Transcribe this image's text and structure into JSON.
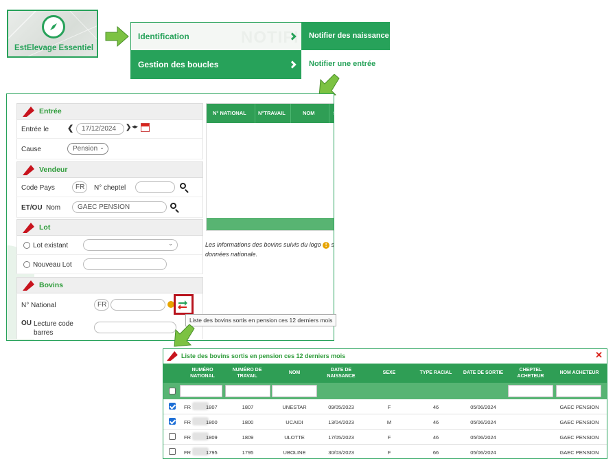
{
  "logo": {
    "text": "EstElevage Essentiel",
    "icon": "compass-icon"
  },
  "menu": {
    "watermark": "NOTIFI",
    "items": [
      {
        "label": "Identification",
        "sub": "Notifier des naissance"
      },
      {
        "label": "Gestion des boucles",
        "sub": "Notifier une entrée"
      }
    ]
  },
  "form": {
    "entree": {
      "title": "Entrée",
      "date_label": "Entrée le",
      "date_value": "17/12/2024",
      "cause_label": "Cause",
      "cause_value": "Pension"
    },
    "vendeur": {
      "title": "Vendeur",
      "pays_label": "Code Pays",
      "pays_value": "FR",
      "cheptel_label": "N° cheptel",
      "etou": "ET/OU",
      "nom_label": "Nom",
      "nom_value": "GAEC PENSION"
    },
    "lot": {
      "title": "Lot",
      "existant_label": "Lot existant",
      "nouveau_label": "Nouveau Lot"
    },
    "bovins": {
      "title": "Bovins",
      "national_label": "N° National",
      "national_prefix": "FR",
      "ou": "OU",
      "lecture_label": "Lecture code barres"
    }
  },
  "right_table": {
    "headers": [
      "N° NATIONAL",
      "N°TRAVAIL",
      "NOM",
      "S"
    ],
    "info_text_1": "Les informations des bovins suivis du logo",
    "info_text_2": "s",
    "info_text_3": "données nationale."
  },
  "tooltip": "Liste des bovins sortis en pension ces 12 derniers mois",
  "list": {
    "title": "Liste des bovins sortis en pension ces 12 derniers mois",
    "close": "✕",
    "headers": [
      "NUMÉRO NATIONAL",
      "NUMÉRO DE TRAVAIL",
      "NOM",
      "DATE DE NAISSANCE",
      "SEXE",
      "TYPE RACIAL",
      "DATE DE SORTIE",
      "CHEPTEL ACHETEUR",
      "NOM ACHETEUR"
    ],
    "rows": [
      {
        "checked": true,
        "pays": "FR",
        "num": "1807",
        "travail": "1807",
        "nom": "UNESTAR",
        "naissance": "09/05/2023",
        "sexe": "F",
        "race": "46",
        "sortie": "05/06/2024",
        "cheptel": "",
        "acheteur": "GAEC PENSION"
      },
      {
        "checked": true,
        "pays": "FR",
        "num": "1800",
        "travail": "1800",
        "nom": "UCAIDI",
        "naissance": "13/04/2023",
        "sexe": "M",
        "race": "46",
        "sortie": "05/06/2024",
        "cheptel": "",
        "acheteur": "GAEC PENSION"
      },
      {
        "checked": false,
        "pays": "FR",
        "num": "1809",
        "travail": "1809",
        "nom": "ULOTTE",
        "naissance": "17/05/2023",
        "sexe": "F",
        "race": "46",
        "sortie": "05/06/2024",
        "cheptel": "",
        "acheteur": "GAEC PENSION"
      },
      {
        "checked": false,
        "pays": "FR",
        "num": "1795",
        "travail": "1795",
        "nom": "UBOLINE",
        "naissance": "30/03/2023",
        "sexe": "F",
        "race": "66",
        "sortie": "05/06/2024",
        "cheptel": "",
        "acheteur": "GAEC PENSION"
      }
    ]
  },
  "colors": {
    "brand_green": "#27a25a",
    "header_green": "#2f9e55",
    "filter_green": "#57b473",
    "red": "#d9241c",
    "checkbox_blue": "#1e6fd6"
  }
}
